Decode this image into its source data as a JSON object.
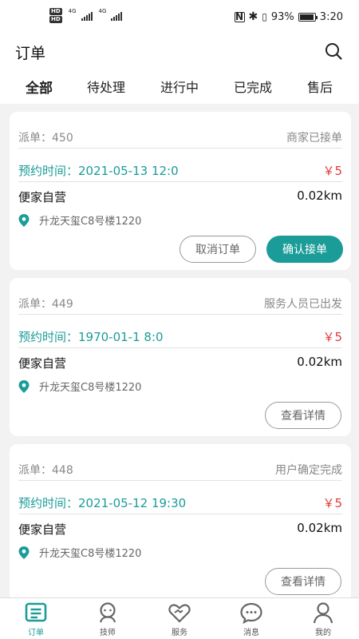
{
  "status_bar": {
    "hd1": "HD",
    "hd2": "HD",
    "net1": "4G",
    "net2": "4G",
    "battery": "93%",
    "time": "3:20"
  },
  "header": {
    "title": "订单",
    "search_icon": "search-icon"
  },
  "tabs": [
    {
      "label": "全部",
      "active": true
    },
    {
      "label": "待处理"
    },
    {
      "label": "进行中"
    },
    {
      "label": "已完成"
    },
    {
      "label": "售后"
    }
  ],
  "orders": [
    {
      "dispatch": "派单：450",
      "status": "商家已接单",
      "time": "预约时间：2021-05-13 12:0",
      "price": "￥5",
      "shop": "便家自营",
      "distance": "0.02km",
      "address": "升龙天玺C8号楼1220",
      "buttons": [
        "取消订单",
        "确认接单"
      ]
    },
    {
      "dispatch": "派单：449",
      "status": "服务人员已出发",
      "time": "预约时间：1970-01-1 8:0",
      "price": "￥5",
      "shop": "便家自营",
      "distance": "0.02km",
      "address": "升龙天玺C8号楼1220",
      "buttons": [
        "查看详情"
      ]
    },
    {
      "dispatch": "派单：448",
      "status": "用户确定完成",
      "time": "预约时间：2021-05-12 19:30",
      "price": "￥5",
      "shop": "便家自营",
      "distance": "0.02km",
      "address": "升龙天玺C8号楼1220",
      "buttons": [
        "查看详情"
      ]
    }
  ],
  "tabbar": [
    {
      "label": "订单",
      "icon": "order-icon",
      "active": true
    },
    {
      "label": "技师",
      "icon": "technician-icon"
    },
    {
      "label": "服务",
      "icon": "service-icon"
    },
    {
      "label": "消息",
      "icon": "message-icon"
    },
    {
      "label": "我的",
      "icon": "profile-icon"
    }
  ],
  "colors": {
    "accent": "#1a9c98",
    "price": "#e23b3b"
  }
}
